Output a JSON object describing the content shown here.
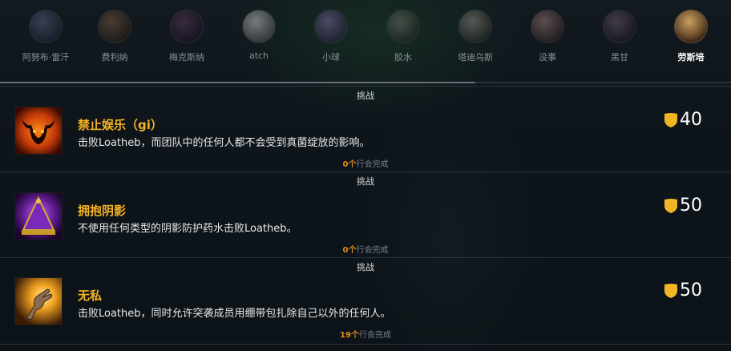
{
  "bosses": [
    {
      "name": "阿努布·雷汗",
      "active": false
    },
    {
      "name": "费利纳",
      "active": false
    },
    {
      "name": "梅克斯纳",
      "active": false
    },
    {
      "name": "atch",
      "active": false
    },
    {
      "name": "小球",
      "active": false
    },
    {
      "name": "胶水",
      "active": false
    },
    {
      "name": "塔迪乌斯",
      "active": false
    },
    {
      "name": "没事",
      "active": false
    },
    {
      "name": "黑甘",
      "active": false
    },
    {
      "name": "劳斯培",
      "active": true
    }
  ],
  "scroll_progress": 0.65,
  "achievements": [
    {
      "category": "挑战",
      "title": "禁止娱乐（gi）",
      "description": "击败Loatheb，而团队中的任何人都不会受到真菌绽放的影响。",
      "points": "40",
      "completed_count": "0个",
      "completed_label": "行会完成",
      "icon": "bull-head-icon"
    },
    {
      "category": "挑战",
      "title": "拥抱阴影",
      "description": "不使用任何类型的阴影防护药水击败Loatheb。",
      "points": "50",
      "completed_count": "0个",
      "completed_label": "行会完成",
      "icon": "purple-pyramid-icon"
    },
    {
      "category": "挑战",
      "title": "无私",
      "description": "击败Loatheb，同时允许突袭成员用绷带包扎除自己以外的任何人。",
      "points": "50",
      "completed_count": "19个",
      "completed_label": "行会完成",
      "icon": "glowing-hand-icon"
    }
  ],
  "colors": {
    "title": "#f5b321",
    "shield": "#f0b623",
    "count": "#e38b17"
  }
}
